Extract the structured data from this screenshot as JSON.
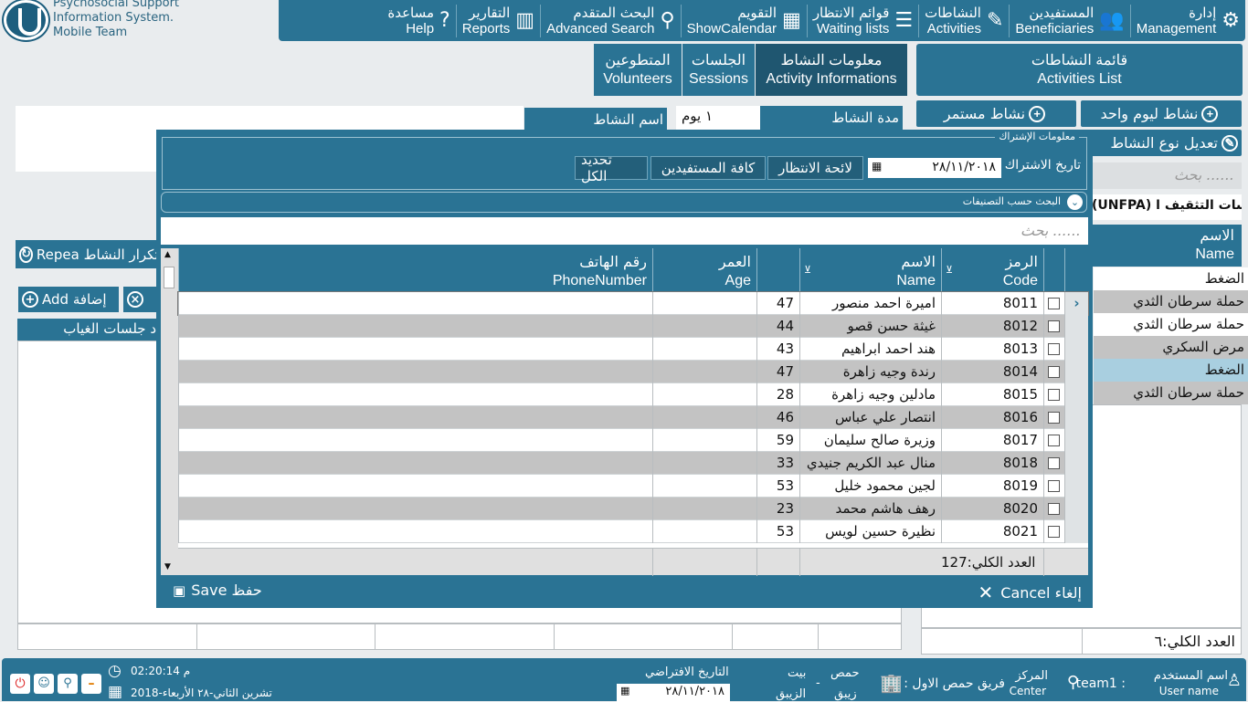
{
  "logo": {
    "line1": "Psychosocial Support",
    "line2": "Information System.",
    "line3": "Mobile Team"
  },
  "nav": [
    {
      "ar": "إدارة",
      "en": "Management",
      "icon": "gear-icon",
      "glyph": "⚙"
    },
    {
      "ar": "المستفيدين",
      "en": "Beneficiaries",
      "icon": "users-icon",
      "glyph": "👥"
    },
    {
      "ar": "النشاطات",
      "en": "Activities",
      "icon": "edit-icon",
      "glyph": "✎"
    },
    {
      "ar": "قوائم الانتظار",
      "en": "Waiting lists",
      "icon": "list-icon",
      "glyph": "☰"
    },
    {
      "ar": "التقويم",
      "en": "ShowCalendar",
      "icon": "calendar-icon",
      "glyph": "▦"
    },
    {
      "ar": "البحث المتقدم",
      "en": "Advanced Search",
      "icon": "search-icon",
      "glyph": "⚲"
    },
    {
      "ar": "التقارير",
      "en": "Reports",
      "icon": "chart-icon",
      "glyph": "▥"
    },
    {
      "ar": "مساعدة",
      "en": "Help",
      "icon": "help-icon",
      "glyph": "?"
    }
  ],
  "tabs": {
    "list_ar": "قائمة النشاطات",
    "list_en": "Activities List",
    "info_ar": "معلومات النشاط",
    "info_en": "Activity Informations",
    "sess_ar": "الجلسات",
    "sess_en": "Sessions",
    "vol_ar": "المتطوعين",
    "vol_en": "Volunteers"
  },
  "right": {
    "one_day": "نشاط ليوم واحد",
    "continuous": "نشاط مستمر",
    "edit_type": "تعديل نوع النشاط",
    "search_placeholder": "بحث ......",
    "group_title": "(UNFPA) جلسات التثقيف ا",
    "col_ar": "الاسم",
    "col_en": "Name",
    "rows": [
      "الضغط",
      "حملة سرطان الثدي",
      "حملة سرطان الثدي",
      "مرض السكري",
      "الضغط",
      "حملة سرطان الثدي"
    ],
    "total": "العدد الكلي:٦"
  },
  "left": {
    "duration_label": "مدة النشاط",
    "duration_value": "١ يوم",
    "name_label": "اسم النشاط",
    "repeat": "Repea تكرار النشاط",
    "add": "Add إضافة",
    "absence_col": "د جلسات الغياب"
  },
  "modal": {
    "section_title": "معلومات الإشتراك",
    "date_label": "تاريخ الاشتراك",
    "date_value": "٢٨/١١/٢٠١٨",
    "waiting": "لائحة الانتظار",
    "all_ben": "كافة المستفيدين",
    "select_all": "تحديد الكل",
    "filter_title": "البحث حسب التصنيفات",
    "search_placeholder": "بحث ......",
    "cols": {
      "code_ar": "الرمز",
      "code_en": "Code",
      "name_ar": "الاسم",
      "name_en": "Name",
      "age_ar": "العمر",
      "age_en": "Age",
      "phone_ar": "رقم الهاتف",
      "phone_en": "PhoneNumber"
    },
    "rows": [
      {
        "code": "8011",
        "name": "اميرة احمد منصور",
        "age": "47"
      },
      {
        "code": "8012",
        "name": "غيثة حسن قصو",
        "age": "44"
      },
      {
        "code": "8013",
        "name": "هند احمد ابراهيم",
        "age": "43"
      },
      {
        "code": "8014",
        "name": "رندة وجيه زاهرة",
        "age": "47"
      },
      {
        "code": "8015",
        "name": "مادلين وجيه زاهرة",
        "age": "28"
      },
      {
        "code": "8016",
        "name": "انتصار علي عباس",
        "age": "46"
      },
      {
        "code": "8017",
        "name": "وزيرة صالح سليمان",
        "age": "59"
      },
      {
        "code": "8018",
        "name": "منال عبد الكريم جنيدي",
        "age": "33"
      },
      {
        "code": "8019",
        "name": "لجين محمود خليل",
        "age": "53"
      },
      {
        "code": "8020",
        "name": "رهف هاشم محمد",
        "age": "23"
      },
      {
        "code": "8021",
        "name": "نظيرة حسين لويس",
        "age": "53"
      }
    ],
    "total": "127:العدد الكلي",
    "save": "Save حفظ",
    "cancel": "Cancel إلغاء"
  },
  "footer": {
    "user_label": "اسم المستخدم",
    "user_label_en": "User name",
    "user": "team1 :",
    "center_label": "المركز",
    "center_en": "Center",
    "center": "فريق حمص الاول :",
    "city1": "حمص",
    "city2": "زيبق",
    "dash": "-",
    "city3": "بيت",
    "city4": "الزيبق",
    "default_date_label": "التاريخ الافتراضي",
    "default_date": "٢٨/١١/٢٠١٨",
    "time": "02:20:14 م",
    "date": "تشرين الثاني-٢٨ الأربعاء-2018"
  }
}
